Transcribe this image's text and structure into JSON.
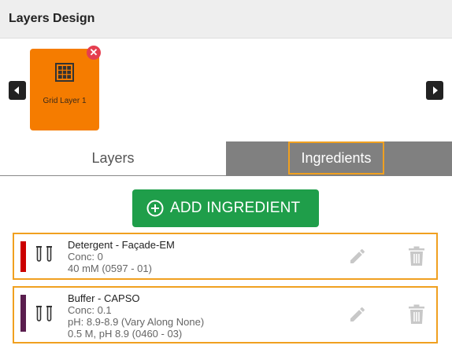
{
  "header": {
    "title": "Layers Design"
  },
  "carousel": {
    "layers": [
      {
        "label": "Grid Layer 1"
      }
    ],
    "card_color": "#f57c00"
  },
  "tabs": [
    {
      "label": "Layers",
      "active": false
    },
    {
      "label": "Ingredients",
      "active": true
    }
  ],
  "add_button": {
    "label": "ADD INGREDIENT",
    "color": "#1f9e4a"
  },
  "ingredients": [
    {
      "name": "Detergent - Façade-EM",
      "conc": "Conc: 0",
      "details": [
        "40 mM (0597 - 01)"
      ],
      "color": "#cc0000"
    },
    {
      "name": "Buffer - CAPSO",
      "conc": "Conc: 0.1",
      "details": [
        "pH: 8.9-8.9 (Vary Along None)",
        "0.5 M, pH 8.9 (0460 - 03)"
      ],
      "color": "#5a1e4e"
    }
  ],
  "icons": [
    "grid-icon",
    "remove-icon",
    "chevron-left-icon",
    "chevron-right-icon",
    "plus-circle-icon",
    "test-tubes-icon",
    "pencil-icon",
    "trash-icon"
  ]
}
